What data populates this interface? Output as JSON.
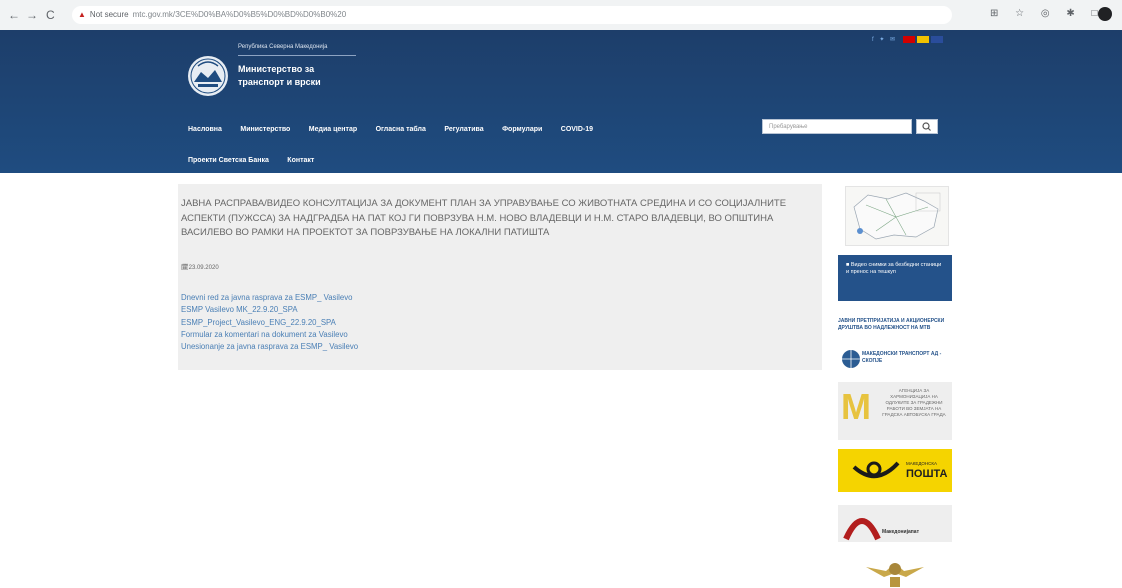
{
  "browser": {
    "nav_back": "←",
    "nav_forward": "→",
    "nav_reload": "C",
    "not_secure": "Not secure",
    "url": "mtc.gov.mk/ЗСЕ%D0%BA%D0%B5%D0%BD%D0%B0%20"
  },
  "header": {
    "republic": "Република Северна Македонија",
    "ministry_line1": "Министерство за",
    "ministry_line2": "транспорт и врски",
    "social": "f ✦ ✉"
  },
  "menu": {
    "items": [
      "Насловна",
      "Министерство",
      "Медиа центар",
      "Огласна табла",
      "Регулатива",
      "Формулари",
      "COVID-19",
      "Проекти Светска Банка",
      "Контакт"
    ]
  },
  "search": {
    "placeholder": "Пребарување"
  },
  "article": {
    "title": "ЈАВНА РАСПРАВА/ВИДЕО КОНСУЛТАЦИЈА ЗА ДОКУМЕНТ ПЛАН ЗА УПРАВУВАЊЕ СО ЖИВОТНАТА СРЕДИНА И СО СОЦИЈАЛНИТЕ АСПЕКТИ (ПУЖССА) ЗА НАДГРАДБА НА ПАТ КОЈ ГИ ПОВРЗУВА Н.М. НОВО ВЛАДЕВЦИ И Н.М. СТАРО ВЛАДЕВЦИ, ВО ОПШТИНА ВАСИЛЕВО ВО РАМКИ НА ПРОЕКТОТ ЗА ПОВРЗУВАЊЕ НА ЛОКАЛНИ ПАТИШТА",
    "date": "23.09.2020",
    "documents": [
      "Dnevni red za javna rasprava za ESMP_ Vasilevo",
      "ESMP Vasilevo MK_22.9.20_SPA",
      "ESMP_Project_Vasilevo_ENG_22.9.20_SPA",
      "Formular za komentari na dokument za Vasilevo",
      "Unesionanje za javna rasprava za ESMP_ Vasilevo"
    ]
  },
  "sidebar": {
    "blue_card": "Видео снимки за безбедни станици и пренос на тешкуп",
    "banner_text": "ЈАВНИ ПРЕТПРИЈАТИЈА И АКЦИОНЕРСКИ ДРУШТВА ВО НАДЛЕЖНОСТ НА МТВ",
    "transport_logo": "МАКЕДОНСКИ ТРАНСПОРТ АД - СКОПЈЕ",
    "mskb_letter": "M",
    "mskb_text": "АГЕНЦИЈА ЗА ХАРМОНИЗАЦИЈА НА ОДЛУКИТЕ ЗА ГРАДЕЖНИ РАБОТИ ВО ЗЕМЈАТА НА ГРАДСКА АВТОБУСКА ГРАДА",
    "posta_small": "МАКЕДОНСКА",
    "posta_big": "ПОШТА",
    "makpat_text": "Македонијапат"
  },
  "colors": {
    "header_bg": "#1f4c80",
    "link": "#4a7fb5",
    "content_bg": "#efefef",
    "posta_yellow": "#f5d400"
  }
}
